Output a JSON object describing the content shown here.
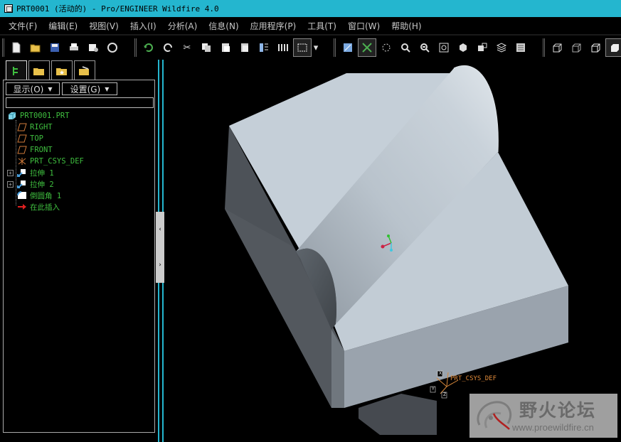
{
  "window": {
    "title": "PRT0001 (活动的) - Pro/ENGINEER Wildfire 4.0"
  },
  "menu": {
    "items": [
      "文件(F)",
      "编辑(E)",
      "视图(V)",
      "插入(I)",
      "分析(A)",
      "信息(N)",
      "应用程序(P)",
      "工具(T)",
      "窗口(W)",
      "帮助(H)"
    ]
  },
  "navigator": {
    "show_label": "显示(O)",
    "settings_label": "设置(G)",
    "filter_value": "",
    "tree": [
      {
        "label": "PRT0001.PRT",
        "icon": "part-icon"
      },
      {
        "label": "RIGHT",
        "icon": "datum-plane-icon"
      },
      {
        "label": "TOP",
        "icon": "datum-plane-icon"
      },
      {
        "label": "FRONT",
        "icon": "datum-plane-icon"
      },
      {
        "label": "PRT_CSYS_DEF",
        "icon": "csys-icon"
      },
      {
        "label": "拉伸 1",
        "icon": "extrude-icon"
      },
      {
        "label": "拉伸 2",
        "icon": "extrude-icon"
      },
      {
        "label": "倒圆角 1",
        "icon": "round-icon"
      },
      {
        "label": "在此插入",
        "icon": "insert-here-arrow-icon"
      }
    ]
  },
  "viewport": {
    "csys_label": "PRT_CSYS_DEF",
    "csys_axes": [
      "X",
      "Y",
      "Z"
    ]
  },
  "watermark": {
    "title": "野火论坛",
    "url": "www.proewildfire.cn"
  },
  "colors": {
    "titlebar": "#24b6cf",
    "tree_text": "#3fbf3f",
    "model_top": "#c5cfd8",
    "model_side_dark": "#4d5258",
    "model_side_light": "#9aa3ad"
  }
}
